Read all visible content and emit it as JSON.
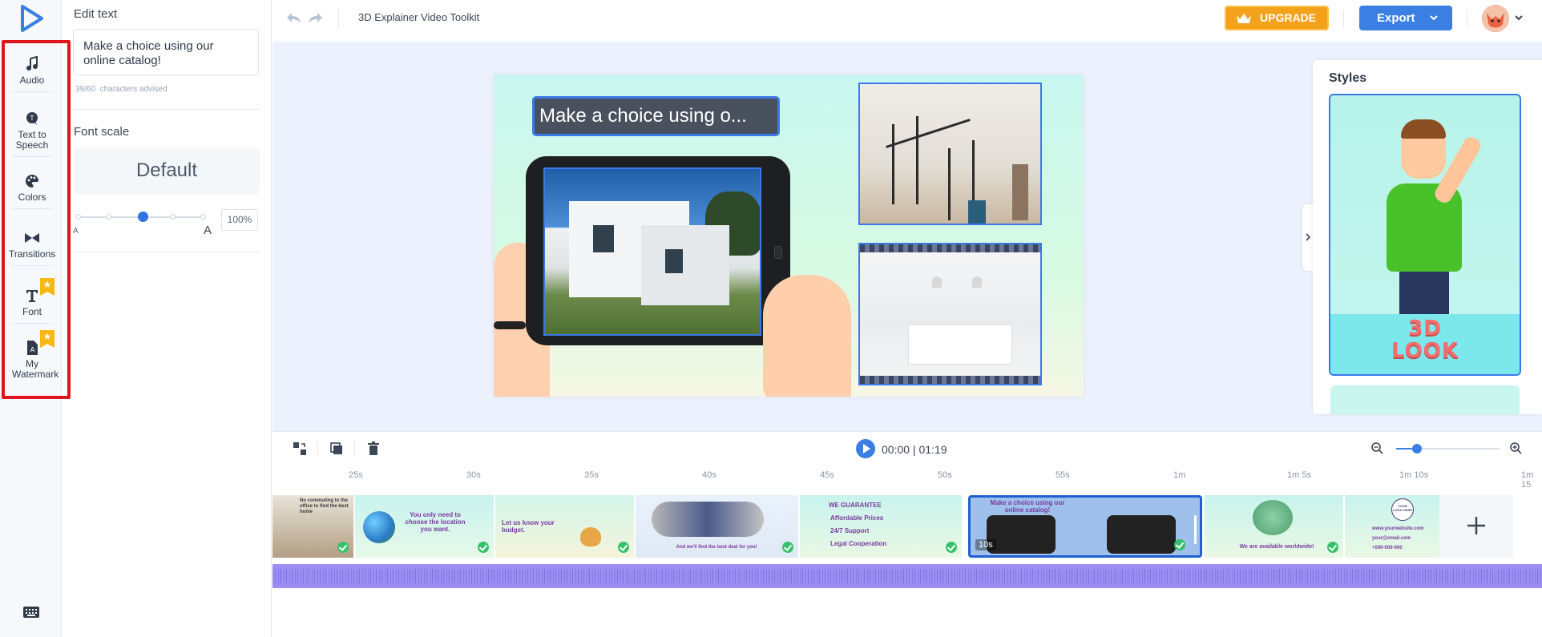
{
  "rail": {
    "items": [
      {
        "label": "Audio",
        "icon": "music-note-icon",
        "premium": false
      },
      {
        "label": "Text to Speech",
        "icon": "text-to-speech-icon",
        "premium": false
      },
      {
        "label": "Colors",
        "icon": "palette-icon",
        "premium": false
      },
      {
        "label": "Transitions",
        "icon": "transitions-icon",
        "premium": false
      },
      {
        "label": "Font",
        "icon": "font-icon",
        "premium": true
      },
      {
        "label": "My Watermark",
        "icon": "watermark-icon",
        "premium": true
      }
    ],
    "keyboard_icon": "keyboard-icon"
  },
  "panel": {
    "title": "Edit text",
    "text_value": "Make a choice using our online catalog!",
    "char_count": "39/60",
    "char_count_suffix": "characters advised",
    "font_scale_label": "Font scale",
    "font_scale_value": "Default",
    "slider_small_label": "A",
    "slider_large_label": "A",
    "slider_percent": "100%",
    "slider_level": 0.5
  },
  "topbar": {
    "project_title": "3D Explainer Video Toolkit",
    "upgrade_label": "UPGRADE",
    "export_label": "Export"
  },
  "canvas": {
    "slide_text": "Make a choice using o..."
  },
  "styles": {
    "title": "Styles",
    "card_label_line1": "3D",
    "card_label_line2": "LOOK"
  },
  "timeline": {
    "time": "00:00 | 01:19",
    "zoom_level": 0.2,
    "ruler": [
      "25s",
      "30s",
      "35s",
      "40s",
      "45s",
      "50s",
      "55s",
      "1m",
      "1m 5s",
      "1m 10s",
      "1m 15"
    ],
    "selected_duration": "10s",
    "scenes": [
      {
        "text": "No commuting to the office to find the best home"
      },
      {
        "text": "You only need to choose the location you want."
      },
      {
        "text": "Let us know your budget."
      },
      {
        "text": "And we'll find the best deal for you!"
      },
      {
        "text": "WE GUARANTEE",
        "items": [
          "Affordable Prices",
          "24/7 Support",
          "Legal Cooperation"
        ]
      },
      {
        "text": "Make a choice using our online catalog!"
      },
      {
        "text": "We are available worldwide!"
      },
      {
        "text": "YOUR LOGO HERE",
        "items": [
          "www.yourwebsite.com",
          "your@email.com",
          "+000-000-000"
        ]
      }
    ]
  },
  "colors": {
    "accent": "#3b7fe3",
    "upgrade": "#f4a21c",
    "highlight": "#e0141b",
    "audio": "#9c8ff2"
  }
}
